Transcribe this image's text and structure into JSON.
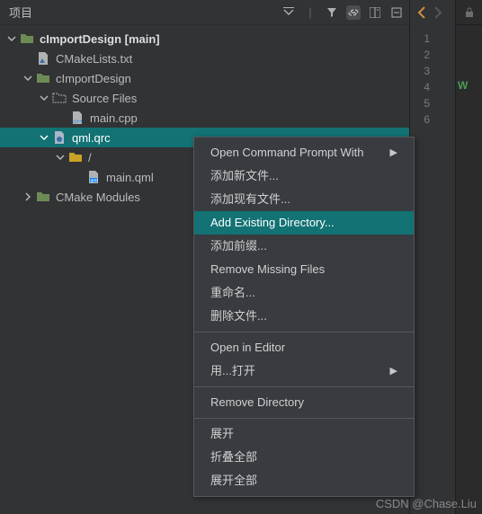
{
  "header": {
    "title": "项目"
  },
  "tree": {
    "root": {
      "label": "cImportDesign [main]"
    },
    "cmakelists": {
      "label": "CMakeLists.txt"
    },
    "project": {
      "label": "cImportDesign"
    },
    "source_files": {
      "label": "Source Files"
    },
    "main_cpp": {
      "label": "main.cpp"
    },
    "qml_qrc": {
      "label": "qml.qrc"
    },
    "root_prefix": {
      "label": "/"
    },
    "main_qml": {
      "label": "main.qml"
    },
    "cmake_modules": {
      "label": "CMake Modules"
    }
  },
  "menu": {
    "open_cmd": "Open Command Prompt With",
    "add_new": "添加新文件...",
    "add_existing": "添加现有文件...",
    "add_existing_dir": "Add Existing Directory...",
    "add_prefix": "添加前缀...",
    "remove_missing": "Remove Missing Files",
    "rename": "重命名...",
    "delete_file": "删除文件...",
    "open_editor": "Open in Editor",
    "open_with": "用...打开",
    "remove_dir": "Remove Directory",
    "expand": "展开",
    "collapse_all": "折叠全部",
    "expand_all": "展开全部"
  },
  "gutter": {
    "lines": [
      "1",
      "2",
      "3",
      "4",
      "5",
      "6"
    ],
    "marker": {
      "text": "W",
      "color": "#499c54"
    }
  },
  "watermark": "CSDN @Chase.Liu"
}
